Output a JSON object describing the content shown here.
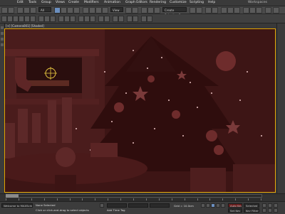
{
  "menubar": {
    "items": [
      "Edit",
      "Tools",
      "Group",
      "Views",
      "Create",
      "Modifiers",
      "Animation",
      "Graph Editors",
      "Rendering",
      "Customize",
      "Scripting",
      "Help"
    ],
    "workspace_label": "Workspaces"
  },
  "toolbar": {
    "selection_filter": "All",
    "view_dropdown": "View",
    "named_set": "Create Selection Se"
  },
  "viewport": {
    "label": "[+] [Camera001] [Shaded]"
  },
  "timeline": {
    "frame_counter": "0 / 100"
  },
  "statusbar": {
    "selection_text": "None Selected",
    "prompt_text": "Click or click-and-drag to select objects",
    "welcome_text": "Welcome to MAXScript",
    "grid_text": "Grid = 10.0cm",
    "autokey_label": "Auto Key",
    "setkey_label": "Set Key",
    "selected_label": "Selected",
    "key_filters_label": "Key Filters...",
    "time_tag": "Add Time Tag"
  },
  "colors": {
    "viewport_bg": "#3a1414",
    "viewport_border": "#e0a300",
    "scene_tint": "#7a2a2a"
  }
}
